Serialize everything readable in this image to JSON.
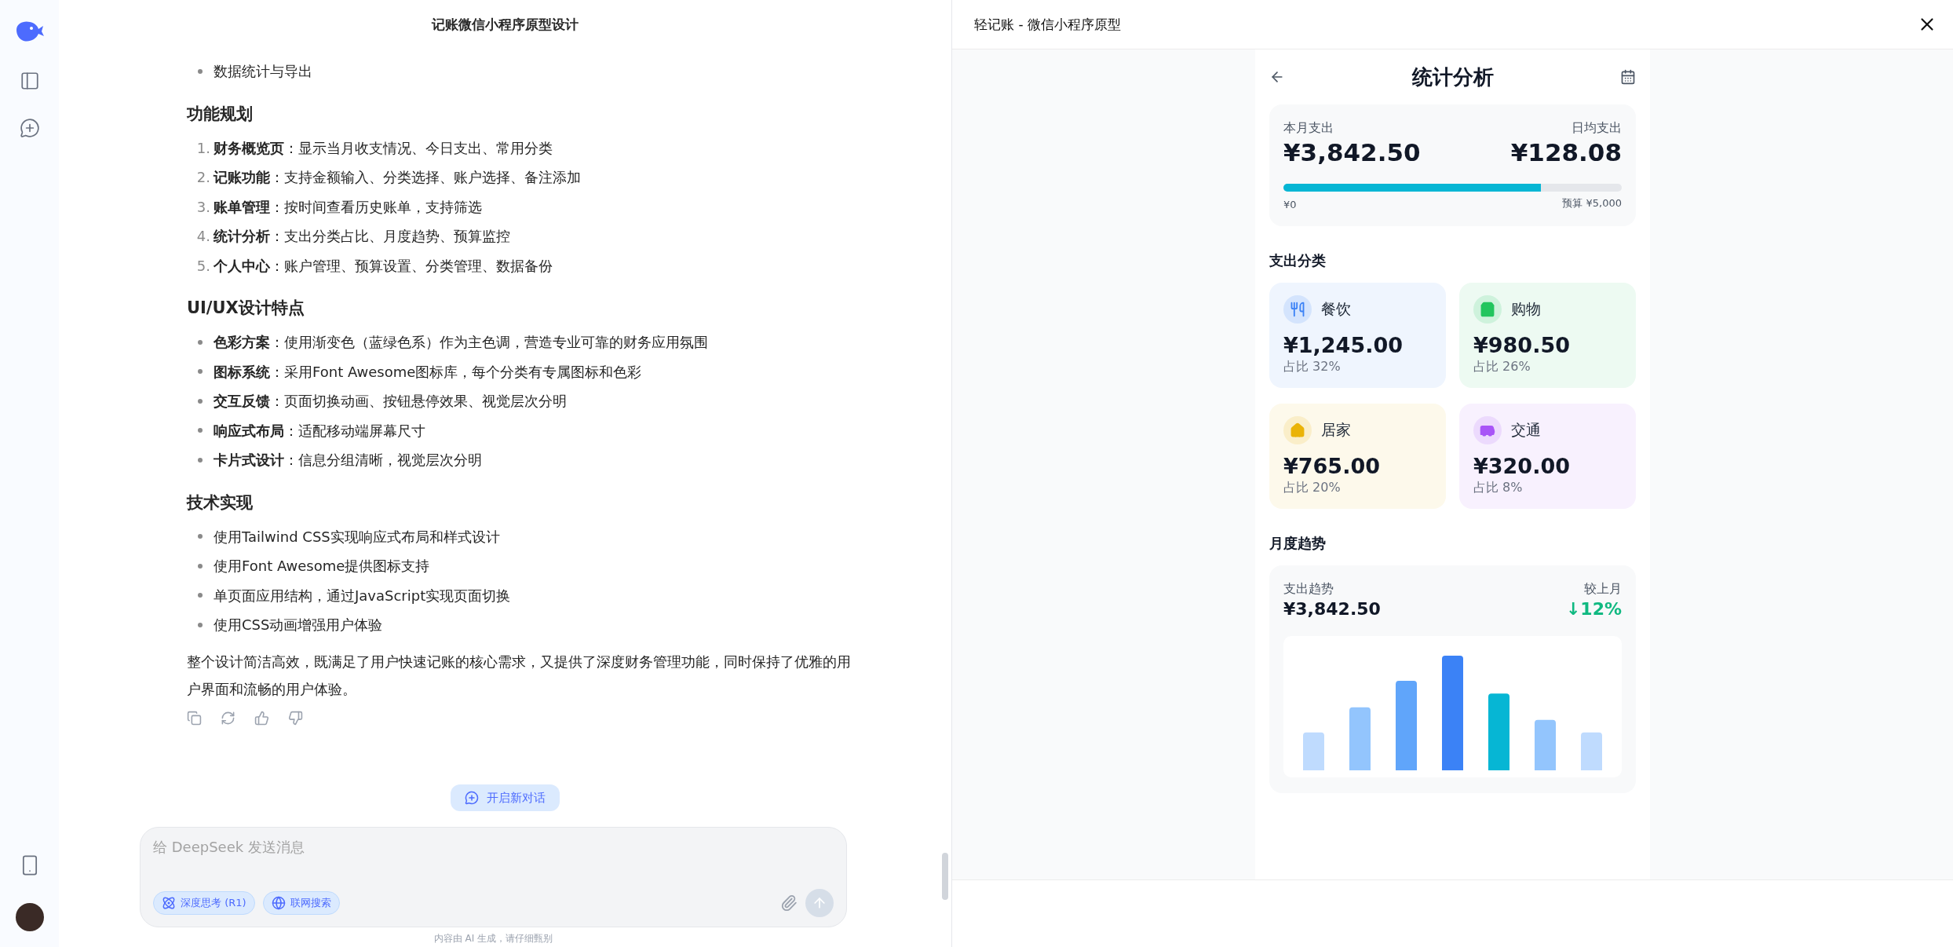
{
  "chat": {
    "title": "记账微信小程序原型设计",
    "blocks": [
      {
        "kind": "bullet",
        "text": "数据统计与导出"
      },
      {
        "kind": "heading",
        "text": "功能规划"
      },
      {
        "kind": "numbered",
        "marker": "1.",
        "text": "**财务概览页**：显示当月收支情况、今日支出、常用分类"
      },
      {
        "kind": "numbered",
        "marker": "2.",
        "text": "**记账功能**：支持金额输入、分类选择、账户选择、备注添加"
      },
      {
        "kind": "numbered",
        "marker": "3.",
        "text": "**账单管理**：按时间查看历史账单，支持筛选"
      },
      {
        "kind": "numbered",
        "marker": "4.",
        "text": "**统计分析**：支出分类占比、月度趋势、预算监控"
      },
      {
        "kind": "numbered",
        "marker": "5.",
        "text": "**个人中心**：账户管理、预算设置、分类管理、数据备份"
      },
      {
        "kind": "heading",
        "text": "UI/UX设计特点"
      },
      {
        "kind": "bullet",
        "text": "**色彩方案**：使用渐变色（蓝绿色系）作为主色调，营造专业可靠的财务应用氛围"
      },
      {
        "kind": "bullet",
        "text": "**图标系统**：采用Font Awesome图标库，每个分类有专属图标和色彩"
      },
      {
        "kind": "bullet",
        "text": "**交互反馈**：页面切换动画、按钮悬停效果、视觉层次分明"
      },
      {
        "kind": "bullet",
        "text": "**响应式布局**：适配移动端屏幕尺寸"
      },
      {
        "kind": "bullet",
        "text": "**卡片式设计**：信息分组清晰，视觉层次分明"
      },
      {
        "kind": "heading",
        "text": "技术实现"
      },
      {
        "kind": "bullet",
        "text": "使用Tailwind CSS实现响应式布局和样式设计"
      },
      {
        "kind": "bullet",
        "text": "使用Font Awesome提供图标支持"
      },
      {
        "kind": "bullet",
        "text": "单页面应用结构，通过JavaScript实现页面切换"
      },
      {
        "kind": "bullet",
        "text": "使用CSS动画增强用户体验"
      },
      {
        "kind": "paragraph",
        "text": "整个设计简洁高效，既满足了用户快速记账的核心需求，又提供了深度财务管理功能，同时保持了优雅的用户界面和流畅的用户体验。"
      }
    ],
    "new_chat_button": "开启新对话",
    "input": {
      "placeholder": "给 DeepSeek 发送消息"
    },
    "toggles": [
      {
        "label": "深度思考 (R1)",
        "selected": true
      },
      {
        "label": "联网搜索",
        "selected": true
      }
    ],
    "footer": "内容由 AI 生成，请仔细甄别"
  },
  "preview": {
    "title": "轻记账 - 微信小程序原型",
    "screen": {
      "title": "统计分析",
      "summary": {
        "month_label": "本月支出",
        "month_amount": "¥3,842.50",
        "daily_label": "日均支出",
        "daily_amount": "¥128.08",
        "level": 0.76,
        "min_label": "¥0",
        "budget_label": "预算 ¥5,000"
      },
      "categories_title": "支出分类",
      "categories": [
        {
          "name": "餐饮",
          "amount": "¥1,245.00",
          "share": "占比 32%",
          "color": "#3b82f6"
        },
        {
          "name": "购物",
          "amount": "¥980.50",
          "share": "占比 26%",
          "color": "#22c55e"
        },
        {
          "name": "居家",
          "amount": "¥765.00",
          "share": "占比 20%",
          "color": "#eab308"
        },
        {
          "name": "交通",
          "amount": "¥320.00",
          "share": "占比 8%",
          "color": "#a855f7"
        }
      ],
      "trend_title": "月度趋势",
      "trend": {
        "label": "支出趋势",
        "amount": "¥3,842.50",
        "compare_label": "较上月",
        "change": "↓12%"
      }
    }
  }
}
